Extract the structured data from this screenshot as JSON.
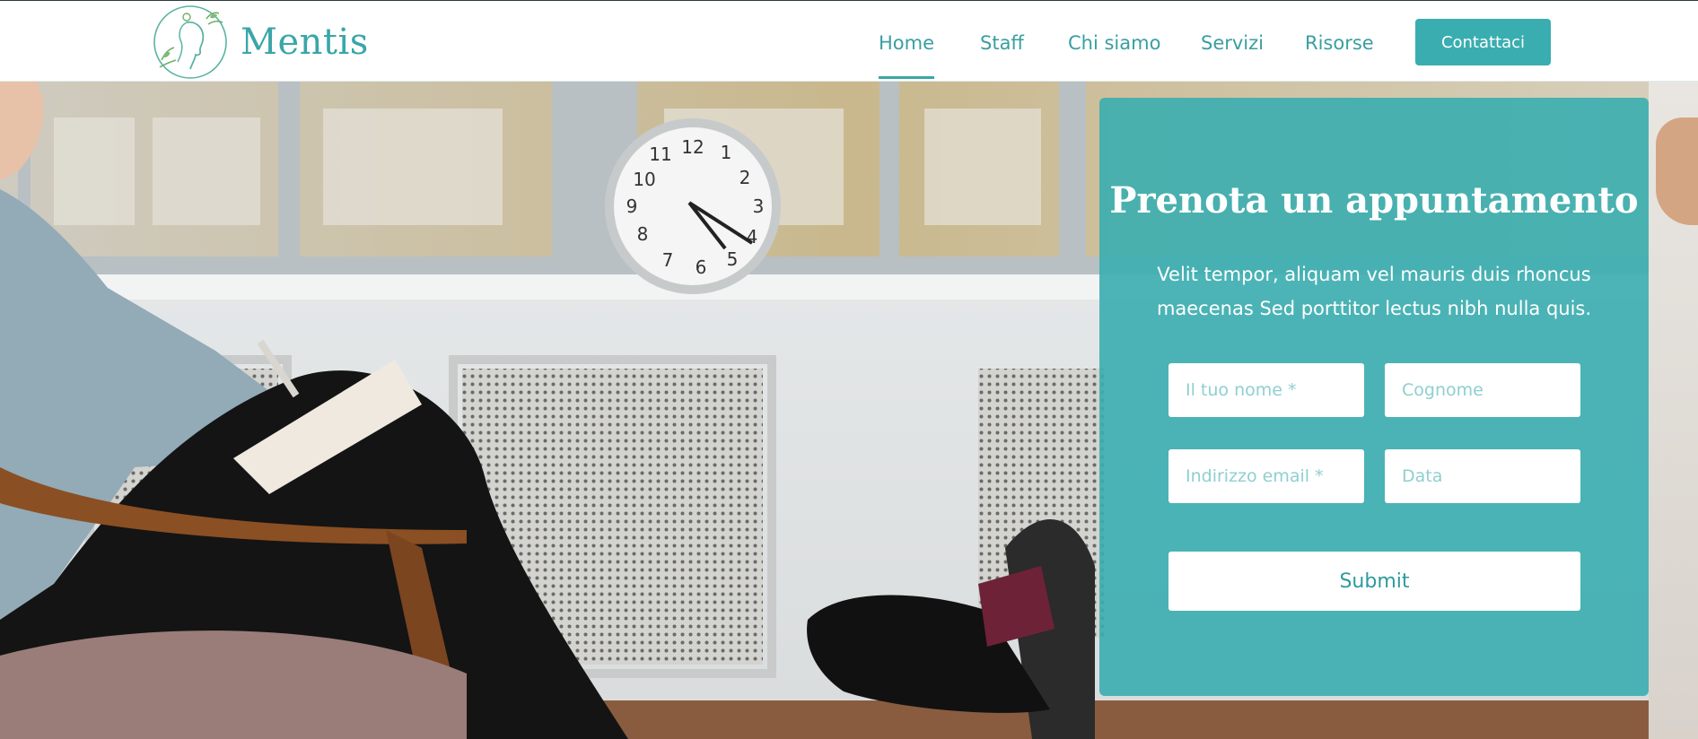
{
  "brand": {
    "name": "Mentis",
    "logo_icon": "woman-profile-wreath-logo"
  },
  "nav": {
    "items": [
      {
        "label": "Home",
        "active": true
      },
      {
        "label": "Staff",
        "active": false
      },
      {
        "label": "Chi siamo",
        "active": false
      },
      {
        "label": "Servizi",
        "active": false
      },
      {
        "label": "Risorse",
        "active": false
      }
    ],
    "cta_label": "Contattaci"
  },
  "booking": {
    "title": "Prenota un appuntamento",
    "description": "Velit tempor, aliquam vel mauris duis rhoncus maecenas Sed porttitor lectus nibh nulla quis.",
    "fields": {
      "first_name_placeholder": "Il tuo nome *",
      "last_name_placeholder": "Cognome",
      "email_placeholder": "Indirizzo email *",
      "date_placeholder": "Data"
    },
    "submit_label": "Submit"
  },
  "colors": {
    "accent": "#3aadb0",
    "card_overlay": "#3baeb0",
    "text_on_accent": "#ffffff"
  }
}
